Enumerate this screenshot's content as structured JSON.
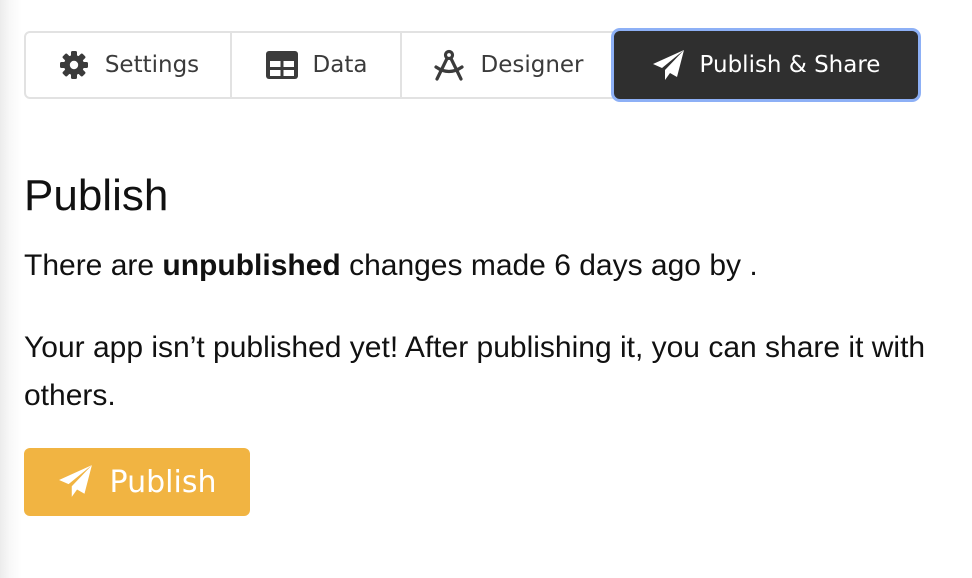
{
  "tabs": {
    "settings": {
      "label": "Settings",
      "icon": "gear-icon"
    },
    "data": {
      "label": "Data",
      "icon": "table-icon"
    },
    "designer": {
      "label": "Designer",
      "icon": "compass-icon"
    },
    "publish": {
      "label": "Publish & Share",
      "icon": "paper-plane-icon",
      "active": true
    }
  },
  "main": {
    "title": "Publish",
    "status": {
      "prefix": "There are ",
      "emphasis": "unpublished",
      "suffix": " changes made 6 days ago by ."
    },
    "info": "Your app isn’t published yet! After publishing it, you can share it with others.",
    "publish_button": {
      "label": "Publish",
      "icon": "paper-plane-icon"
    }
  },
  "colors": {
    "active_tab_bg": "#2f2f2f",
    "focus_ring": "#8db0f6",
    "publish_button": "#f1b442"
  }
}
